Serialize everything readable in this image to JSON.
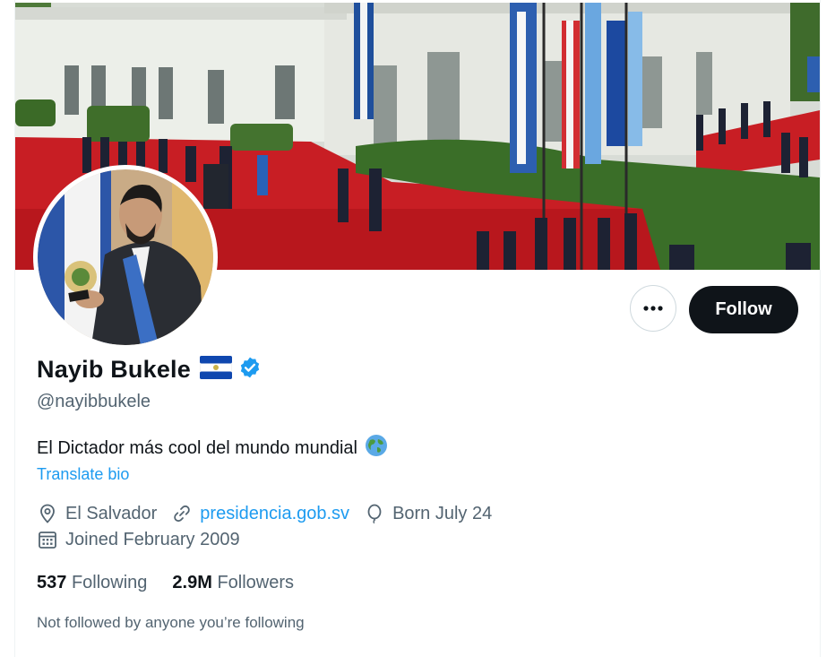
{
  "profile": {
    "display_name": "Nayib Bukele",
    "handle": "@nayibbukele",
    "bio": "El Dictador más cool del mundo mundial",
    "translate_label": "Translate bio",
    "location": "El Salvador",
    "website": "presidencia.gob.sv",
    "birthday": "Born July 24",
    "joined": "Joined February 2009",
    "following_count": "537",
    "following_label": "Following",
    "followers_count": "2.9M",
    "followers_label": "Followers",
    "followers_you_know": "Not followed by anyone you’re following"
  },
  "actions": {
    "more_icon": "more-horizontal-icon",
    "follow_label": "Follow"
  },
  "icons": {
    "verified": "verified-badge-icon",
    "flag": "el-salvador-flag-emoji",
    "globe": "globe-emoji",
    "location": "location-pin-icon",
    "link": "link-icon",
    "birthday": "balloon-icon",
    "joined": "calendar-icon"
  },
  "colors": {
    "accent": "#1d9bf0",
    "text_primary": "#0f1419",
    "text_secondary": "#536471",
    "follow_bg": "#0f1419",
    "flag_blue": "#0f47af"
  }
}
